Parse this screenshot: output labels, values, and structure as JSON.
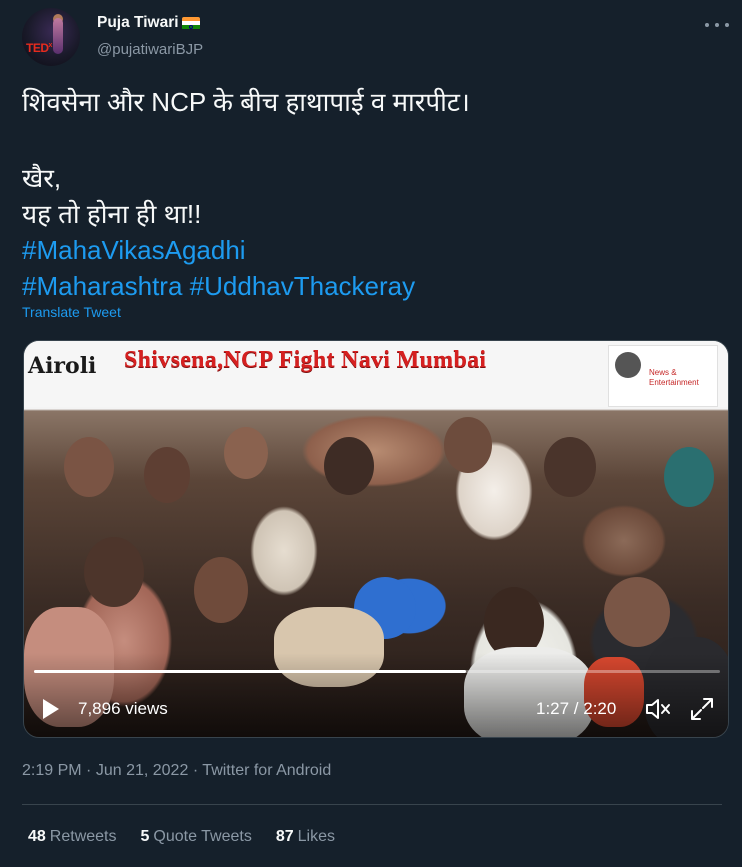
{
  "tweet": {
    "author": {
      "name": "Puja Tiwari",
      "handle": "@pujatiwariBJP",
      "avatar_text": "TED",
      "flag": "india-flag-emoji"
    },
    "lines": [
      "शिवसेना और NCP के बीच हाथापाई व मारपीट।",
      "खैर,",
      "यह तो होना ही था!!"
    ],
    "hashtags": [
      "#MahaVikasAgadhi",
      "#Maharashtra",
      "#UddhavThackeray"
    ],
    "translate_label": "Translate Tweet"
  },
  "video": {
    "location_text": "Airoli",
    "title_text": "Shivsena,NCP Fight Navi Mumbai",
    "logo_text": "News & Entertainment",
    "views": "7,896 views",
    "time": "1:27 / 2:20",
    "progress": 0.63
  },
  "meta": {
    "time": "2:19 PM",
    "date": "Jun 21, 2022",
    "source": "Twitter for Android",
    "separator": "·"
  },
  "stats": [
    {
      "count": "48",
      "label": "Retweets"
    },
    {
      "count": "5",
      "label": "Quote Tweets"
    },
    {
      "count": "87",
      "label": "Likes"
    }
  ],
  "colors": {
    "background": "#15202b",
    "link": "#1d9bf0",
    "muted": "#8b98a5",
    "text": "#f7f9f9"
  }
}
